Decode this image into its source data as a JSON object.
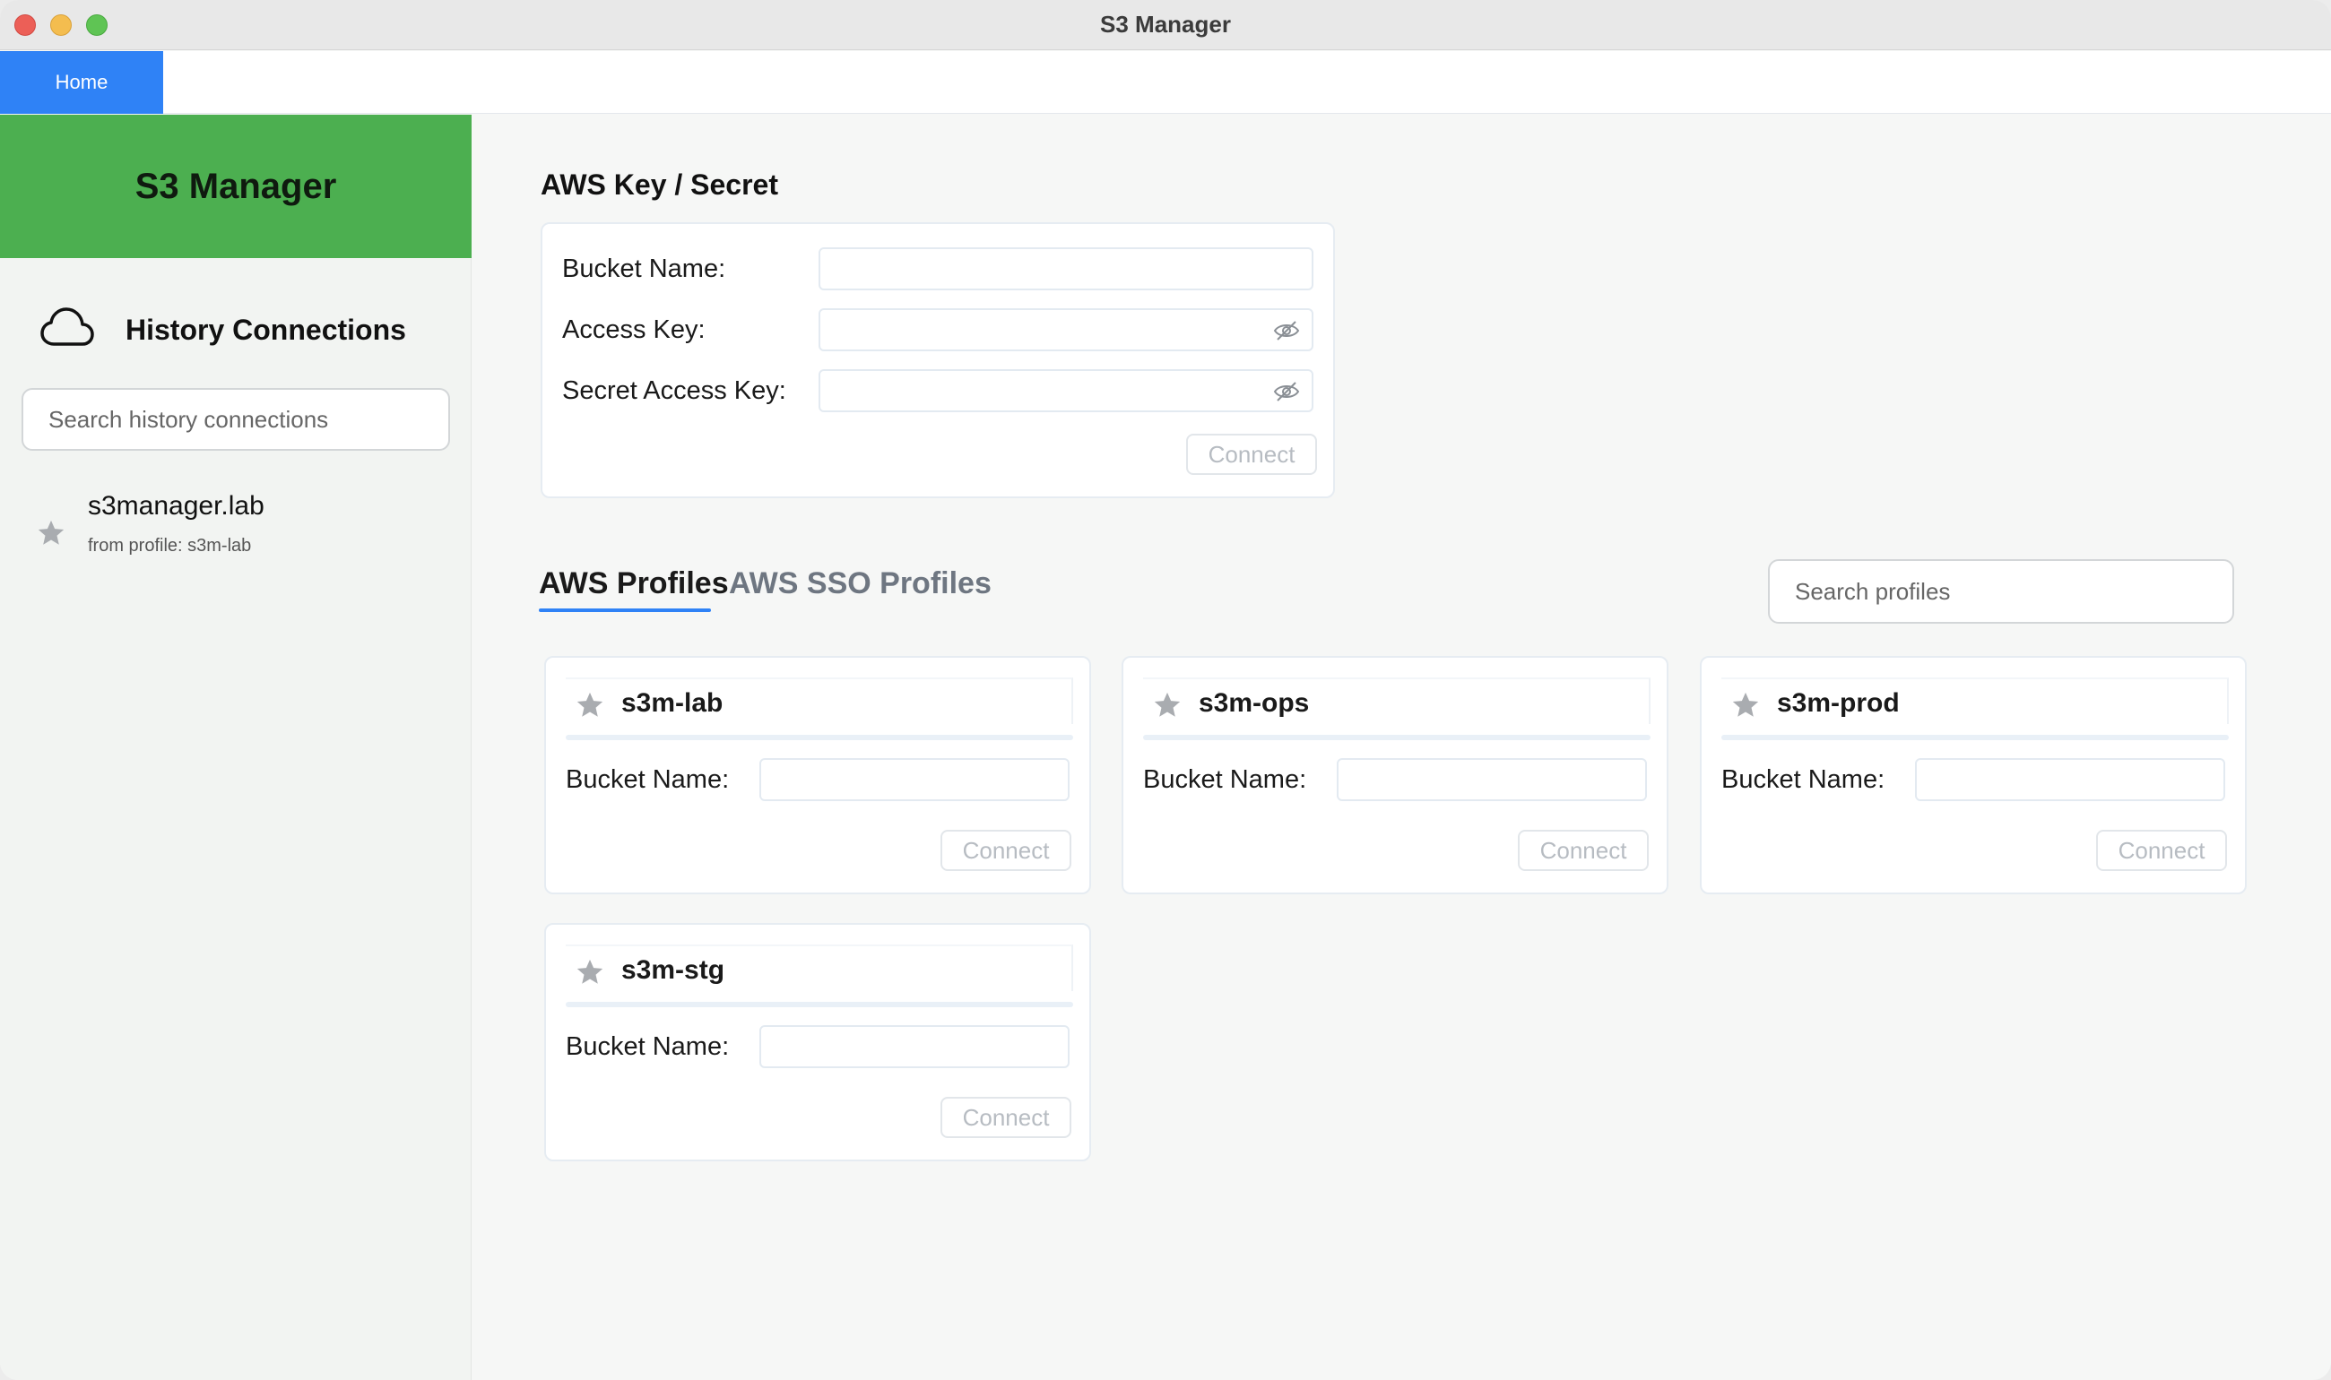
{
  "window": {
    "title": "S3 Manager"
  },
  "tabs": {
    "home_label": "Home"
  },
  "sidebar": {
    "brand": "S3 Manager",
    "history_title": "History Connections",
    "search_placeholder": "Search history connections",
    "items": [
      {
        "name": "s3manager.lab",
        "subtitle": "from profile: s3m-lab"
      }
    ]
  },
  "key_form": {
    "title": "AWS Key / Secret",
    "bucket_label": "Bucket Name:",
    "access_label": "Access Key:",
    "secret_label": "Secret Access Key:",
    "connect_label": "Connect"
  },
  "profiles": {
    "tabs": [
      "AWS Profiles",
      "AWS SSO Profiles"
    ],
    "search_placeholder": "Search profiles",
    "bucket_label": "Bucket Name:",
    "connect_label": "Connect",
    "cards": [
      {
        "name": "s3m-lab"
      },
      {
        "name": "s3m-ops"
      },
      {
        "name": "s3m-prod"
      },
      {
        "name": "s3m-stg"
      }
    ]
  },
  "colors": {
    "brand_green": "#4caf50",
    "accent_blue": "#2f82f6",
    "disabled_text": "#b7bcc2"
  },
  "icons": {
    "history": "cloud-icon",
    "favorite": "star-icon",
    "reveal": "eye-slash-icon"
  }
}
